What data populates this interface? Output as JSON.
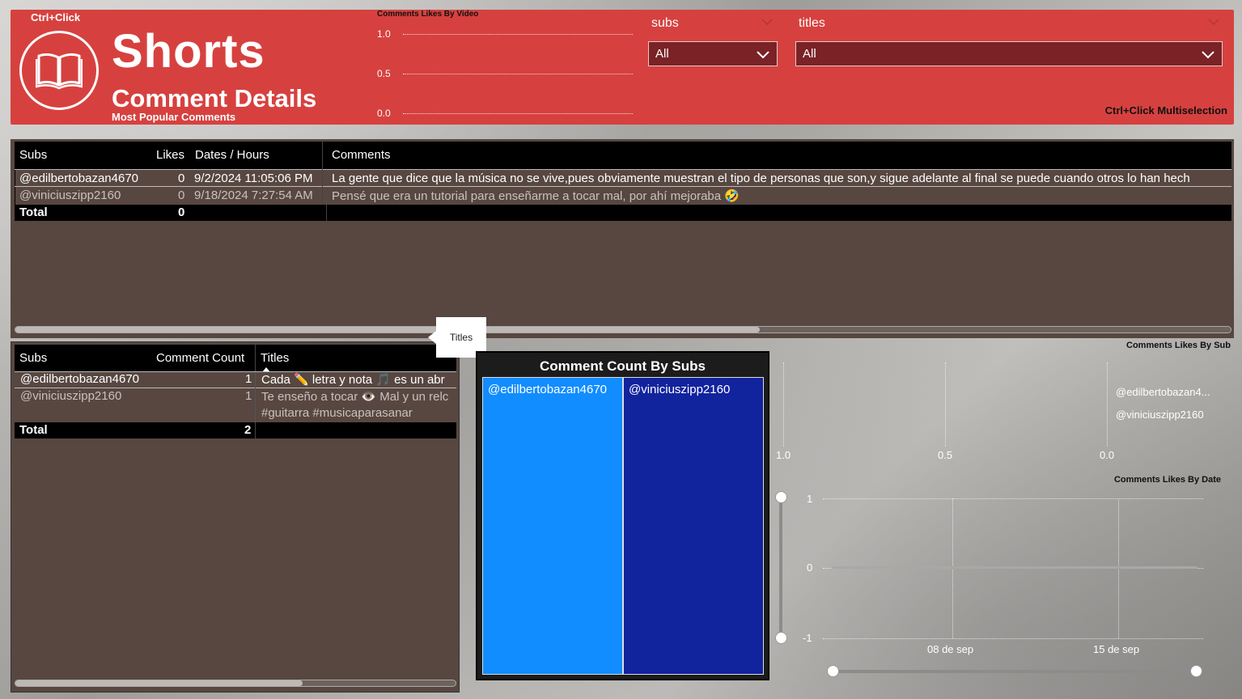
{
  "header": {
    "ctrl_click": "Ctrl+Click",
    "title": "Shorts",
    "subtitle": "Comment Details",
    "tagline": "Most Popular Comments",
    "multiselection": "Ctrl+Click Multiselection",
    "bg_color": "#d6413f"
  },
  "likes_by_video": {
    "title": "Comments Likes By Video",
    "ticks": [
      "1.0",
      "0.5",
      "0.0"
    ]
  },
  "slicers": {
    "subs": {
      "label": "subs",
      "value": "All"
    },
    "titles": {
      "label": "titles",
      "value": "All"
    }
  },
  "comments_table": {
    "headers": [
      "Subs",
      "Likes",
      "Dates / Hours",
      "Comments"
    ],
    "rows": [
      {
        "sub": "@edilbertobazan4670",
        "likes": "0",
        "date": "9/2/2024 11:05:06 PM",
        "comment": "La gente que dice que la música no se vive,pues obviamente muestran el tipo de personas que son,y sigue adelante al final se puede cuando otros lo han hech"
      },
      {
        "sub": "@viniciuszipp2160",
        "likes": "0",
        "date": "9/18/2024 7:27:54 AM",
        "comment": "Pensé que era un tutorial para enseñarme a tocar mal, por ahí mejoraba 🤣"
      }
    ],
    "total_label": "Total",
    "total_likes": "0"
  },
  "tooltip": {
    "text": "Titles"
  },
  "count_table": {
    "headers": [
      "Subs",
      "Comment Count",
      "Titles"
    ],
    "rows": [
      {
        "sub": "@edilbertobazan4670",
        "count": "1",
        "title": "Cada ✏️ letra y nota 🎵 es un abr"
      },
      {
        "sub": "@viniciuszipp2160",
        "count": "1",
        "title": "Te enseño a tocar 👁️ Mal y un relc",
        "title2": "#guitarra #musicaparasanar"
      }
    ],
    "total_label": "Total",
    "total_count": "2"
  },
  "treemap": {
    "title": "Comment Count By Subs",
    "cells": [
      {
        "label": "@edilbertobazan4670",
        "color": "#118dff"
      },
      {
        "label": "@viniciuszipp2160",
        "color": "#12239e"
      }
    ]
  },
  "likes_by_sub": {
    "title": "Comments Likes By Sub",
    "legend": [
      "@edilbertobazan4...",
      "@viniciuszipp2160"
    ],
    "ticks": [
      "1.0",
      "0.5",
      "0.0"
    ]
  },
  "likes_by_date": {
    "title": "Comments Likes By Date",
    "y_ticks": [
      "1",
      "0",
      "-1"
    ],
    "x_ticks": [
      "08 de sep",
      "15 de sep"
    ]
  },
  "chart_data": [
    {
      "type": "bar",
      "title": "Comments Likes By Video",
      "categories": [],
      "values": [],
      "ylim": [
        0,
        1
      ],
      "yticks": [
        1.0,
        0.5,
        0.0
      ]
    },
    {
      "type": "heatmap",
      "title": "Comment Count By Subs",
      "categories": [
        "@edilbertobazan4670",
        "@viniciuszipp2160"
      ],
      "values": [
        1,
        1
      ]
    },
    {
      "type": "bar",
      "title": "Comments Likes By Sub",
      "categories": [
        "@edilbertobazan4...",
        "@viniciuszipp2160"
      ],
      "values": [
        0,
        0
      ],
      "xlim": [
        1.0,
        0.0
      ],
      "xticks": [
        1.0,
        0.5,
        0.0
      ]
    },
    {
      "type": "line",
      "title": "Comments Likes By Date",
      "x": [
        "2024-09-02",
        "2024-09-18"
      ],
      "values": [
        0,
        0
      ],
      "ylim": [
        -1,
        1
      ],
      "xticks": [
        "08 de sep",
        "15 de sep"
      ]
    }
  ]
}
